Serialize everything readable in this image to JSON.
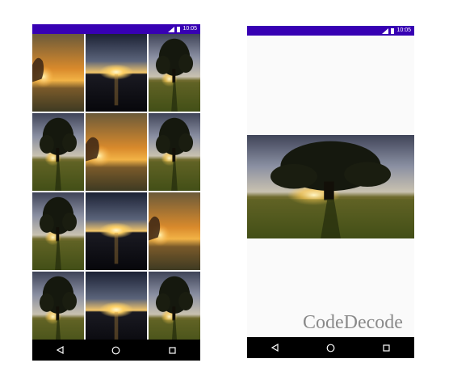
{
  "status_bar": {
    "time": "10:05",
    "icons": [
      "signal-icon",
      "battery-icon"
    ]
  },
  "nav_bar": {
    "buttons": [
      "back-triangle-icon",
      "home-circle-icon",
      "recents-square-icon"
    ]
  },
  "colors": {
    "status_bar": "#3700b3",
    "nav_bar": "#000000",
    "background": "#fafafa"
  },
  "grid_left": {
    "tiles": [
      "sunset-field-image",
      "sea-sunset-image",
      "tree-sunset-image",
      "tree-sunset-image",
      "sunset-field-image",
      "tree-sunset-image",
      "tree-sunset-image",
      "sea-sunset-image",
      "sunset-field-image",
      "tree-sunset-image",
      "sea-sunset-image",
      "tree-sunset-image"
    ]
  },
  "preview": {
    "image": "tree-sunset-image"
  },
  "watermark": "CodeDecode"
}
